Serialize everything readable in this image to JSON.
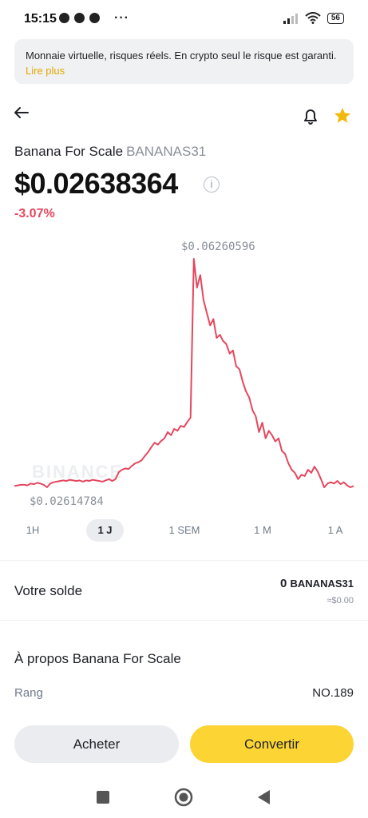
{
  "status_bar": {
    "time": "15:15",
    "battery": "56"
  },
  "banner": {
    "text": "Monnaie virtuelle, risques réels. En crypto seul le risque est garanti.",
    "link": "Lire plus"
  },
  "coin": {
    "name": "Banana For Scale",
    "symbol": "BANANAS31",
    "price": "$0.02638364",
    "change": "-3.07%",
    "info_icon": "i"
  },
  "chart_data": {
    "type": "line",
    "high_label": "$0.06260596",
    "low_label": "$0.02614784",
    "watermark": "BINANCE",
    "color": "#e5475f",
    "values": [
      0.0264,
      0.0265,
      0.0266,
      0.0266,
      0.0265,
      0.0268,
      0.0267,
      0.0269,
      0.0268,
      0.0266,
      0.0262,
      0.0268,
      0.027,
      0.0271,
      0.0272,
      0.0273,
      0.0272,
      0.0274,
      0.0273,
      0.0272,
      0.0273,
      0.0271,
      0.0273,
      0.0272,
      0.0274,
      0.0273,
      0.0272,
      0.0271,
      0.0273,
      0.0275,
      0.0272,
      0.0275,
      0.0286,
      0.029,
      0.0292,
      0.0291,
      0.0296,
      0.03,
      0.0302,
      0.0305,
      0.0312,
      0.0318,
      0.0326,
      0.0333,
      0.033,
      0.0336,
      0.034,
      0.035,
      0.0345,
      0.0355,
      0.0352,
      0.036,
      0.0358,
      0.0366,
      0.0373,
      0.0626,
      0.058,
      0.06,
      0.056,
      0.054,
      0.052,
      0.053,
      0.05,
      0.0505,
      0.0495,
      0.049,
      0.0475,
      0.048,
      0.0455,
      0.045,
      0.043,
      0.0415,
      0.0405,
      0.0385,
      0.0375,
      0.035,
      0.0365,
      0.034,
      0.0352,
      0.0345,
      0.0335,
      0.034,
      0.032,
      0.0315,
      0.03,
      0.029,
      0.0285,
      0.0275,
      0.0282,
      0.028,
      0.029,
      0.0285,
      0.0295,
      0.0287,
      0.0275,
      0.0262,
      0.0268,
      0.027,
      0.0268,
      0.0272,
      0.0267,
      0.027,
      0.0265,
      0.0262,
      0.0264
    ]
  },
  "timeframes": [
    {
      "label": "1H",
      "active": false
    },
    {
      "label": "1 J",
      "active": true
    },
    {
      "label": "1 SEM",
      "active": false
    },
    {
      "label": "1 M",
      "active": false
    },
    {
      "label": "1 A",
      "active": false
    }
  ],
  "balance": {
    "label": "Votre solde",
    "amount": "0",
    "symbol": "BANANAS31",
    "fiat": "≈$0.00"
  },
  "about": {
    "title": "À propos Banana For Scale",
    "rank_label": "Rang",
    "rank_value": "NO.189"
  },
  "actions": {
    "buy": "Acheter",
    "convert": "Convertir"
  },
  "colors": {
    "accent_yellow": "#fcd535",
    "negative": "#e5475f",
    "link": "#e1a800"
  },
  "icons": {
    "back": "arrow-left-icon",
    "bell": "bell-icon",
    "star": "star-icon"
  }
}
